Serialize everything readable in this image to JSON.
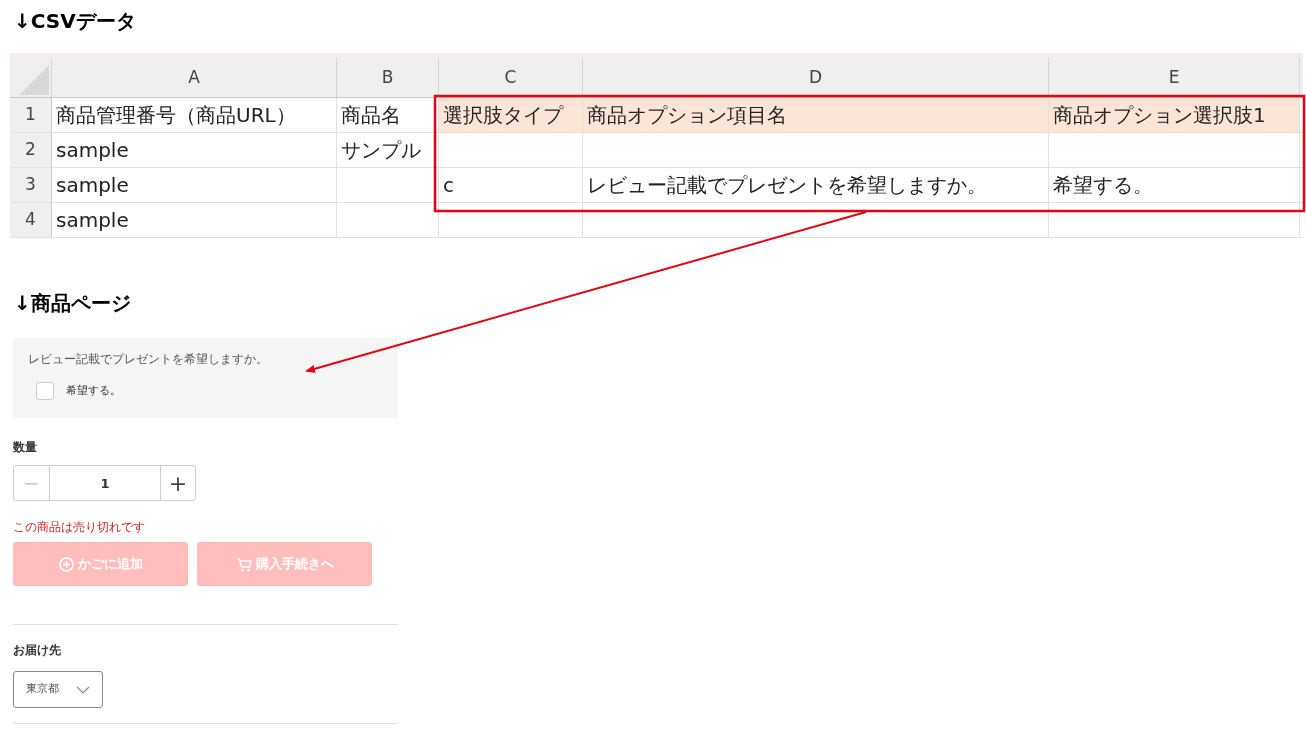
{
  "csv_section": {
    "heading": "↓CSVデータ",
    "columns": [
      "A",
      "B",
      "C",
      "D",
      "E"
    ],
    "rows": [
      {
        "number": "1",
        "cells": [
          {
            "text": "商品管理番号（商品URL）",
            "highlighted": false
          },
          {
            "text": "商品名",
            "highlighted": false
          },
          {
            "text": "選択肢タイプ",
            "highlighted": true
          },
          {
            "text": "商品オプション項目名",
            "highlighted": true
          },
          {
            "text": "商品オプション選択肢1",
            "highlighted": true
          }
        ]
      },
      {
        "number": "2",
        "cells": [
          {
            "text": "sample",
            "highlighted": false
          },
          {
            "text": "サンプル",
            "highlighted": false
          },
          {
            "highlighted": false
          },
          {
            "highlighted": false
          },
          {
            "highlighted": false
          }
        ]
      },
      {
        "number": "3",
        "cells": [
          {
            "text": "sample",
            "highlighted": false
          },
          {
            "highlighted": false
          },
          {
            "text": "c",
            "highlighted": false
          },
          {
            "text": "レビュー記載でプレゼントを希望しますか。",
            "highlighted": false
          },
          {
            "text": "希望する。",
            "highlighted": false
          }
        ]
      },
      {
        "number": "4",
        "cells": [
          {
            "text": "sample",
            "highlighted": false
          },
          {
            "highlighted": false
          },
          {
            "highlighted": false
          },
          {
            "highlighted": false
          },
          {
            "highlighted": false
          }
        ]
      }
    ]
  },
  "product_section": {
    "heading": "↓商品ページ",
    "option": {
      "question": "レビュー記載でプレゼントを希望しますか。",
      "choice": "希望する。",
      "checked": false
    },
    "quantity": {
      "label": "数量",
      "value": "1",
      "minus": "−",
      "plus": "+",
      "minus_disabled": true
    },
    "sold_out_notice": "この商品は売り切れです",
    "buttons": [
      {
        "kind": "add",
        "label": "かごに追加",
        "disabled": true
      },
      {
        "kind": "checkout",
        "label": "購入手続きへ",
        "disabled": true
      }
    ],
    "delivery": {
      "label": "お届け先",
      "value": "東京都"
    }
  }
}
